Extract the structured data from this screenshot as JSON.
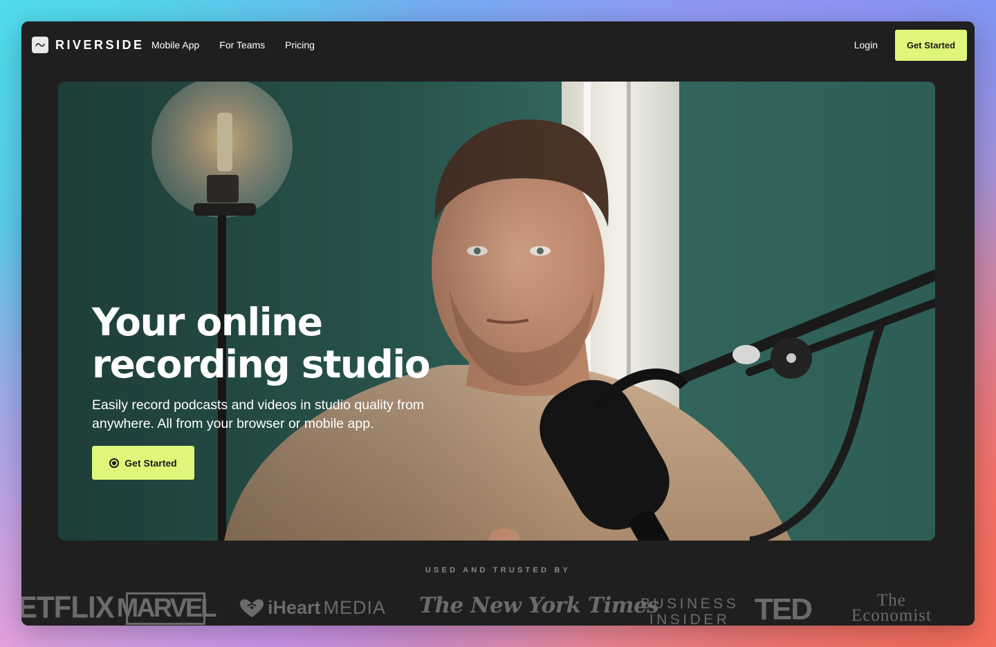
{
  "nav": {
    "logo_text": "RIVERSIDE",
    "links": [
      "Mobile App",
      "For Teams",
      "Pricing"
    ],
    "login": "Login",
    "cta": "Get Started"
  },
  "hero": {
    "title_line1": "Your online",
    "title_line2": "recording studio",
    "subtitle": "Easily record podcasts and videos in studio quality from anywhere. All from your browser or mobile app.",
    "cta": "Get Started"
  },
  "trusted": {
    "label": "USED AND TRUSTED BY",
    "brands": {
      "netflix": "ETFLIX",
      "marvel": "MARVEL",
      "iheart_bold": "iHeart",
      "iheart_light": "MEDIA",
      "nyt": "The New York Times",
      "bi_line1": "BUSINESS",
      "bi_line2": "INSIDER",
      "ted": "TED",
      "econ_line1": "The",
      "econ_line2": "Economist"
    }
  },
  "colors": {
    "accent": "#dff67a",
    "window_bg": "#1f1f1f",
    "hero_wall": "#2f6259"
  }
}
